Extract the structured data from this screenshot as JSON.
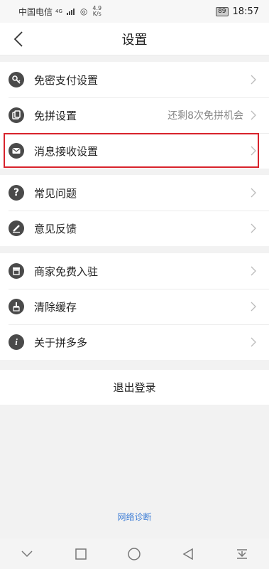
{
  "status_bar": {
    "carrier": "中国电信",
    "network": "4G",
    "speed_value": "4.9",
    "speed_unit": "K/s",
    "battery": "89",
    "time": "18:57"
  },
  "header": {
    "title": "设置"
  },
  "groups": [
    {
      "items": [
        {
          "label": "免密支付设置",
          "icon": "key-icon"
        },
        {
          "label": "免拼设置",
          "icon": "coupon-icon",
          "value": "还剩8次免拼机会"
        },
        {
          "label": "消息接收设置",
          "icon": "mail-icon",
          "highlighted": true
        }
      ]
    },
    {
      "items": [
        {
          "label": "常见问题",
          "icon": "question-icon"
        },
        {
          "label": "意见反馈",
          "icon": "pencil-icon"
        }
      ]
    },
    {
      "items": [
        {
          "label": "商家免费入驻",
          "icon": "store-icon"
        },
        {
          "label": "清除缓存",
          "icon": "broom-icon"
        },
        {
          "label": "关于拼多多",
          "icon": "info-icon"
        }
      ]
    }
  ],
  "logout_label": "退出登录",
  "network_diagnosis_label": "网络诊断",
  "colors": {
    "highlight_border": "#d8232c",
    "link": "#3a7bd5",
    "icon_bg": "#4a4a4a"
  }
}
